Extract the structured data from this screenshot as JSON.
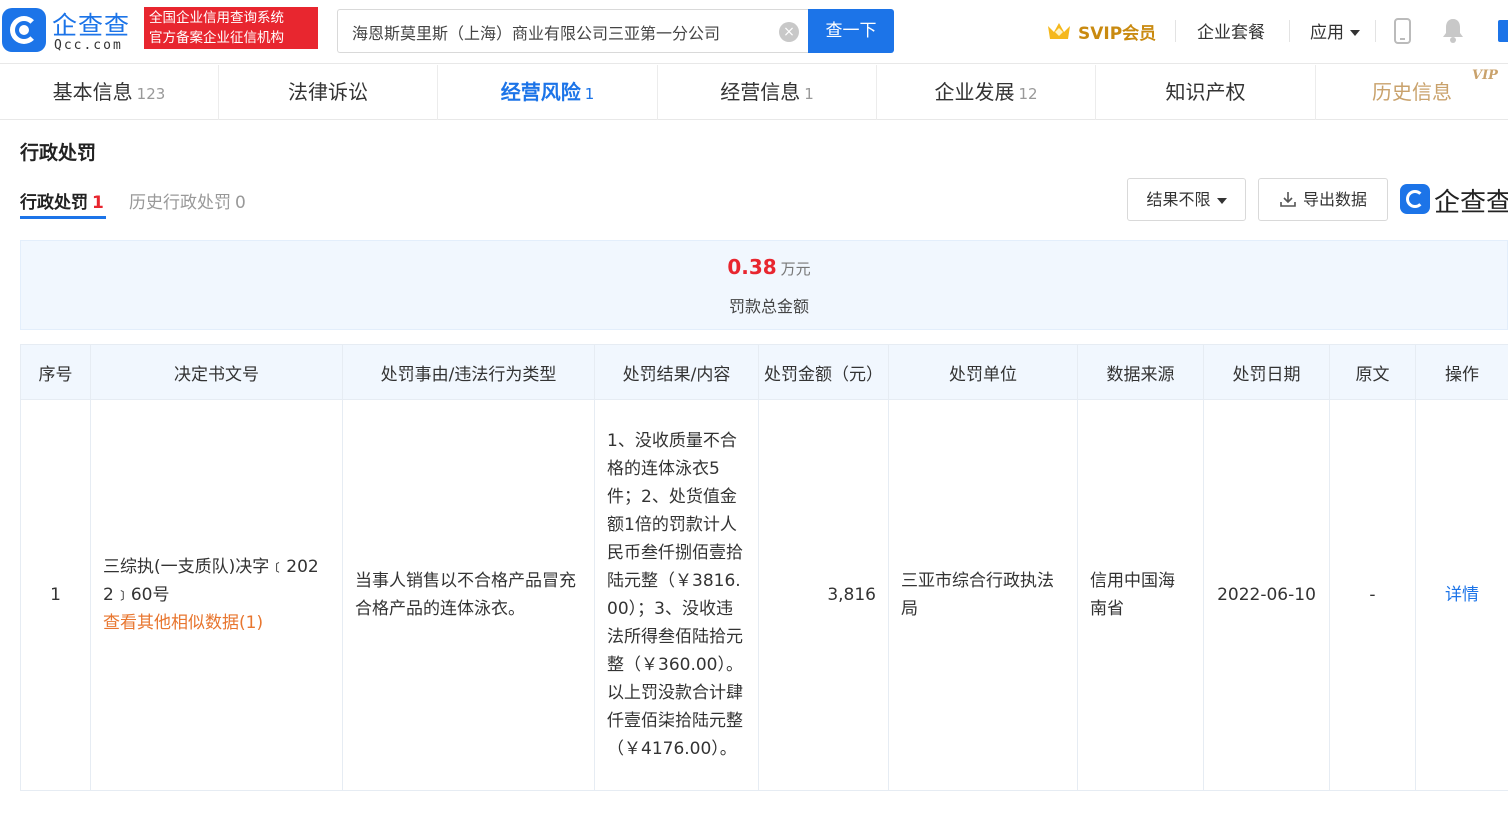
{
  "header": {
    "logo_cn": "企查查",
    "logo_en": "Qcc.com",
    "badge_line1": "全国企业信用查询系统",
    "badge_line2": "官方备案企业征信机构",
    "search_value": "海恩斯莫里斯（上海）商业有限公司三亚第一分公司",
    "search_button": "查一下",
    "svip_label": "SVIP会员",
    "nav_package": "企业套餐",
    "nav_apps": "应用",
    "accent_color": "#1c74e8"
  },
  "tabs": [
    {
      "label": "基本信息",
      "count": "123"
    },
    {
      "label": "法律诉讼",
      "count": ""
    },
    {
      "label": "经营风险",
      "count": "1"
    },
    {
      "label": "经营信息",
      "count": "1"
    },
    {
      "label": "企业发展",
      "count": "12"
    },
    {
      "label": "知识产权",
      "count": ""
    },
    {
      "label": "历史信息",
      "count": ""
    }
  ],
  "vip_mark": "VIP",
  "section": {
    "title": "行政处罚",
    "subtab1_label": "行政处罚",
    "subtab1_count": "1",
    "subtab2_label": "历史行政处罚",
    "subtab2_count": "0",
    "filter_label": "结果不限",
    "export_label": "导出数据",
    "watermark_text": "企查查"
  },
  "summary": {
    "amount": "0.38",
    "unit": "万元",
    "label": "罚款总金额"
  },
  "table": {
    "headers": [
      "序号",
      "决定书文号",
      "处罚事由/违法行为类型",
      "处罚结果/内容",
      "处罚金额（元）",
      "处罚单位",
      "数据来源",
      "处罚日期",
      "原文",
      "操作"
    ],
    "rows": [
      {
        "index": "1",
        "doc_no": "三综执(一支质队)决字﹝2022﹞60号",
        "similar_link": "查看其他相似数据(1)",
        "reason": "当事人销售以不合格产品冒充合格产品的连体泳衣。",
        "result": "1、没收质量不合格的连体泳衣5件；2、处货值金额1倍的罚款计人民币叁仟捌佰壹拾陆元整（￥3816.00）；3、没收违法所得叁佰陆拾元整（￥360.00）。以上罚没款合计肆仟壹佰柒拾陆元整（￥4176.00）。",
        "amount": "3,816",
        "unit": "三亚市综合行政执法局",
        "source": "信用中国海南省",
        "date": "2022-06-10",
        "original": "-",
        "action": "详情"
      }
    ]
  }
}
